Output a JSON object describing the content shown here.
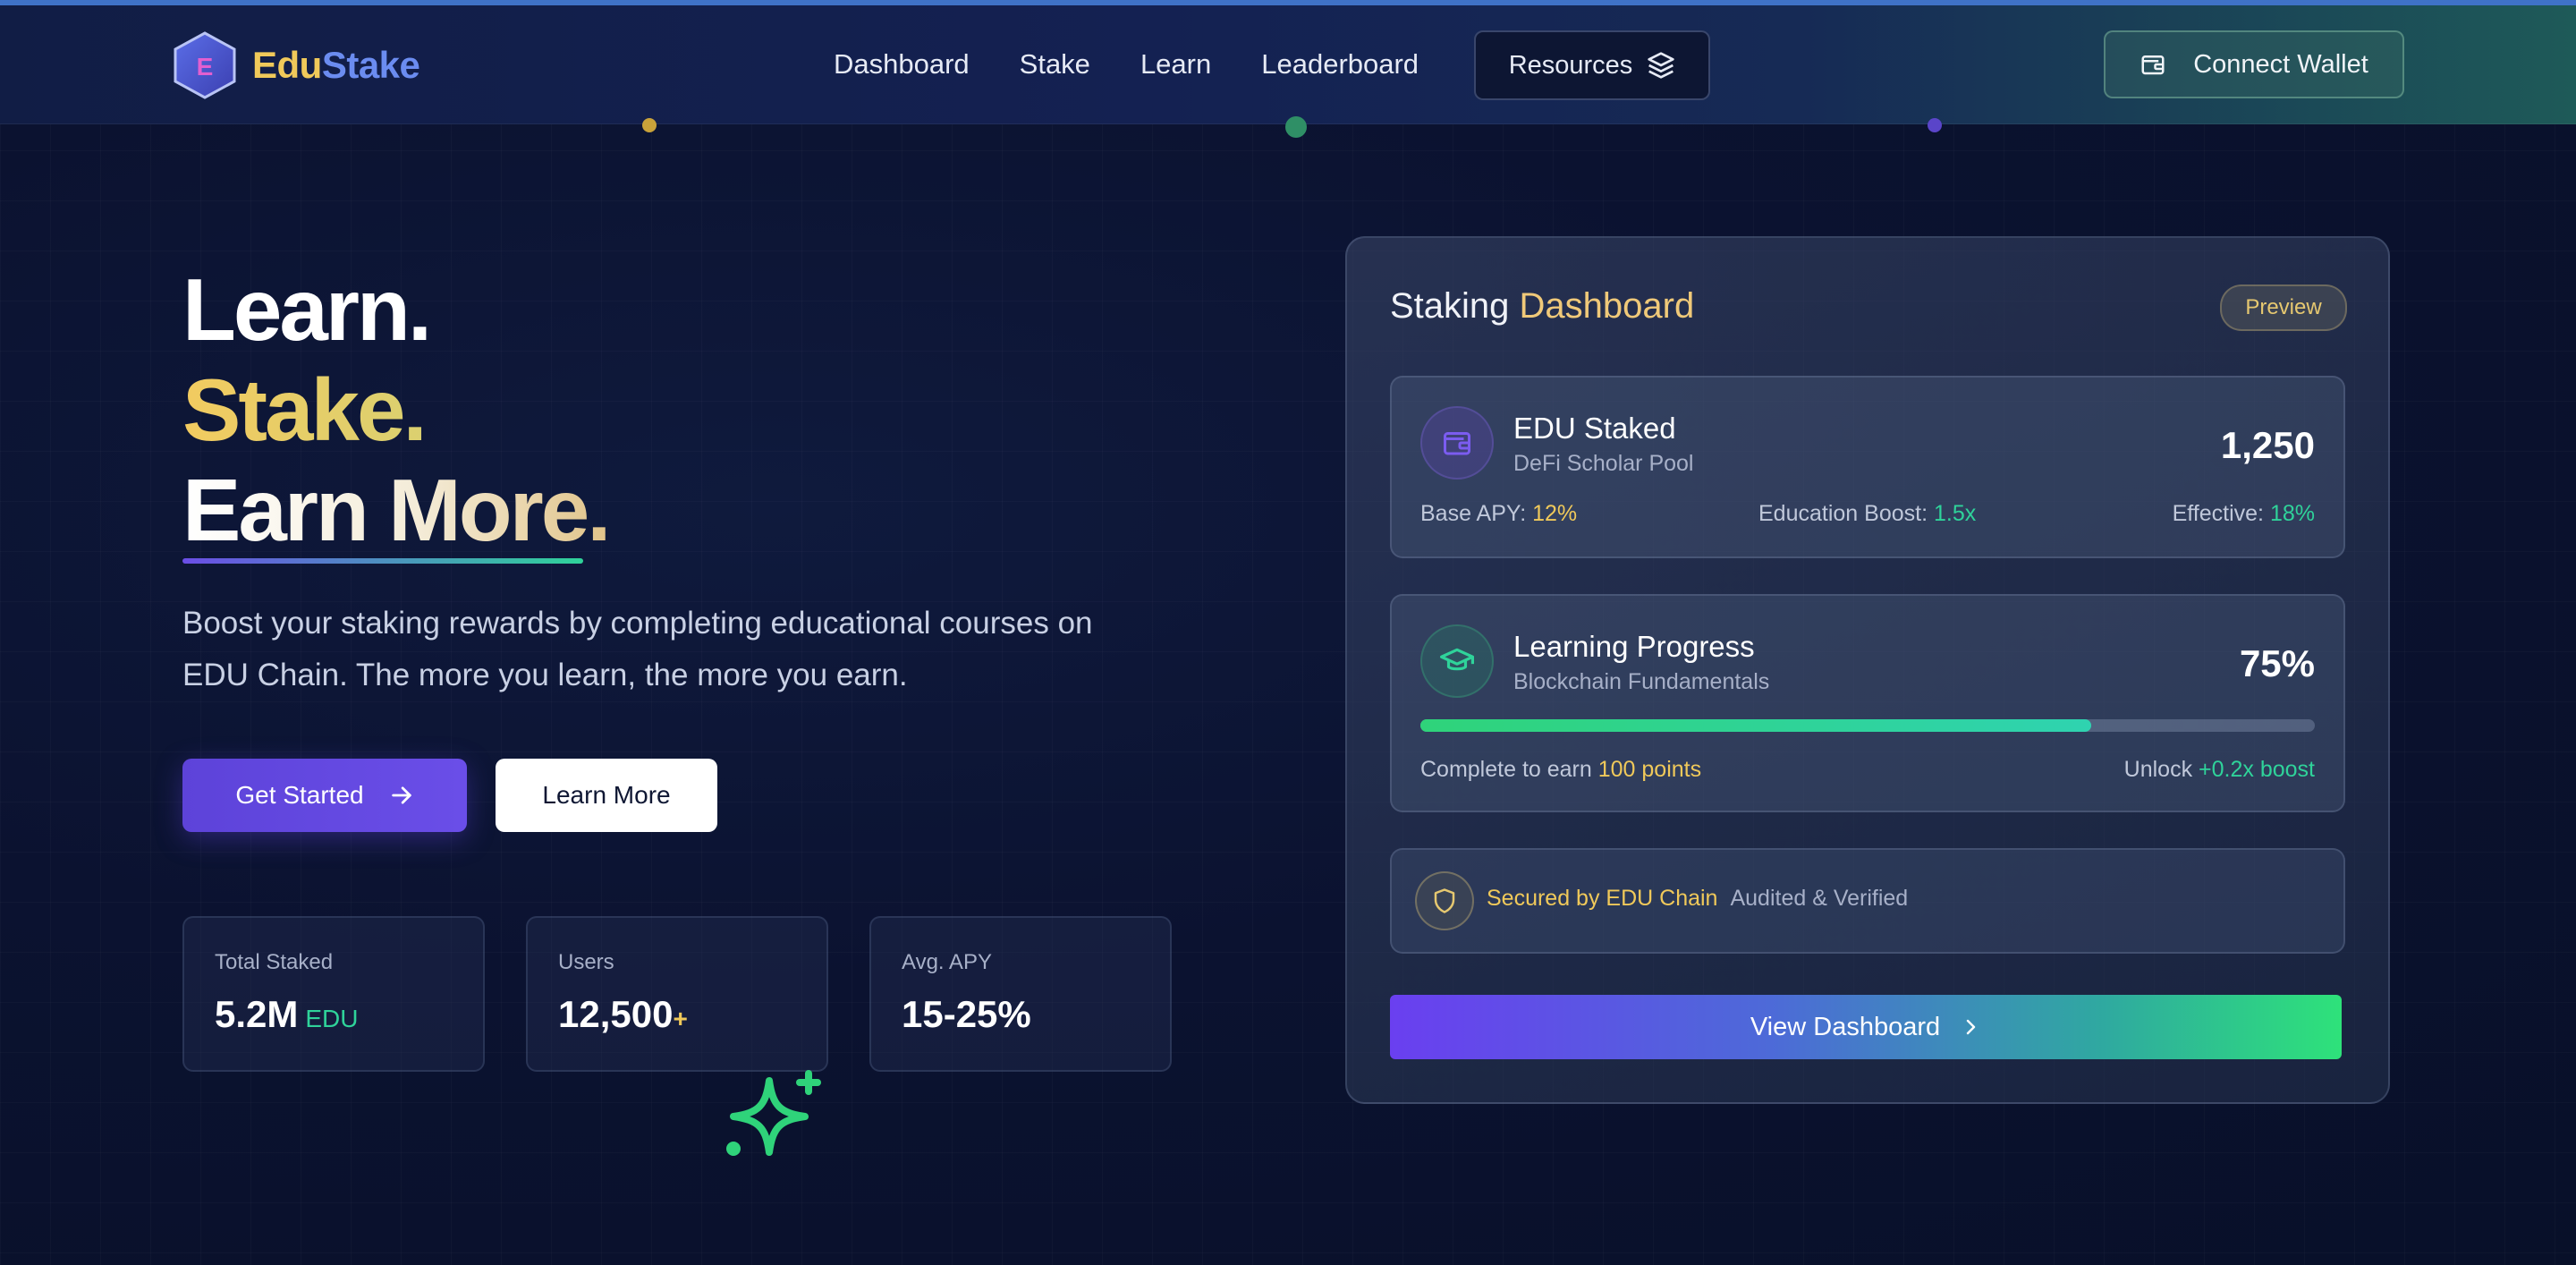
{
  "brand": {
    "logo_letter": "E",
    "name_part1": "Edu",
    "name_part2": "Stake"
  },
  "nav": {
    "links": [
      "Dashboard",
      "Stake",
      "Learn",
      "Leaderboard"
    ],
    "resources_label": "Resources",
    "connect_label": "Connect Wallet"
  },
  "hero": {
    "line1": "Learn.",
    "line2": "Stake.",
    "line3": "Earn More.",
    "description": "Boost your staking rewards by completing educational courses on EDU Chain. The more you learn, the more you earn.",
    "primary_button": "Get Started",
    "secondary_button": "Learn More"
  },
  "stats": [
    {
      "label": "Total Staked",
      "value": "5.2M",
      "suffix": "EDU"
    },
    {
      "label": "Users",
      "value": "12,500",
      "suffix": "+"
    },
    {
      "label": "Avg. APY",
      "value": "15-25%",
      "suffix": ""
    }
  ],
  "dashboard": {
    "title_part1": "Staking",
    "title_part2": "Dashboard",
    "badge": "Preview",
    "staked": {
      "title": "EDU Staked",
      "subtitle": "DeFi Scholar Pool",
      "amount": "1,250",
      "base_apy_label": "Base APY:",
      "base_apy": "12%",
      "boost_label": "Education Boost:",
      "boost": "1.5x",
      "effective_label": "Effective:",
      "effective": "18%"
    },
    "progress": {
      "title": "Learning Progress",
      "subtitle": "Blockchain Fundamentals",
      "percent_label": "75%",
      "percent": 0.75,
      "earn_text": "Complete to earn",
      "earn_points": "100 points",
      "unlock_text": "Unlock",
      "unlock_boost": "+0.2x boost"
    },
    "secured": {
      "title": "Secured by EDU Chain",
      "subtitle": "Audited & Verified"
    },
    "view_button": "View Dashboard"
  },
  "colors": {
    "accent_purple": "#6a4ee8",
    "accent_green": "#2fd39a",
    "accent_gold": "#f0c95a"
  }
}
